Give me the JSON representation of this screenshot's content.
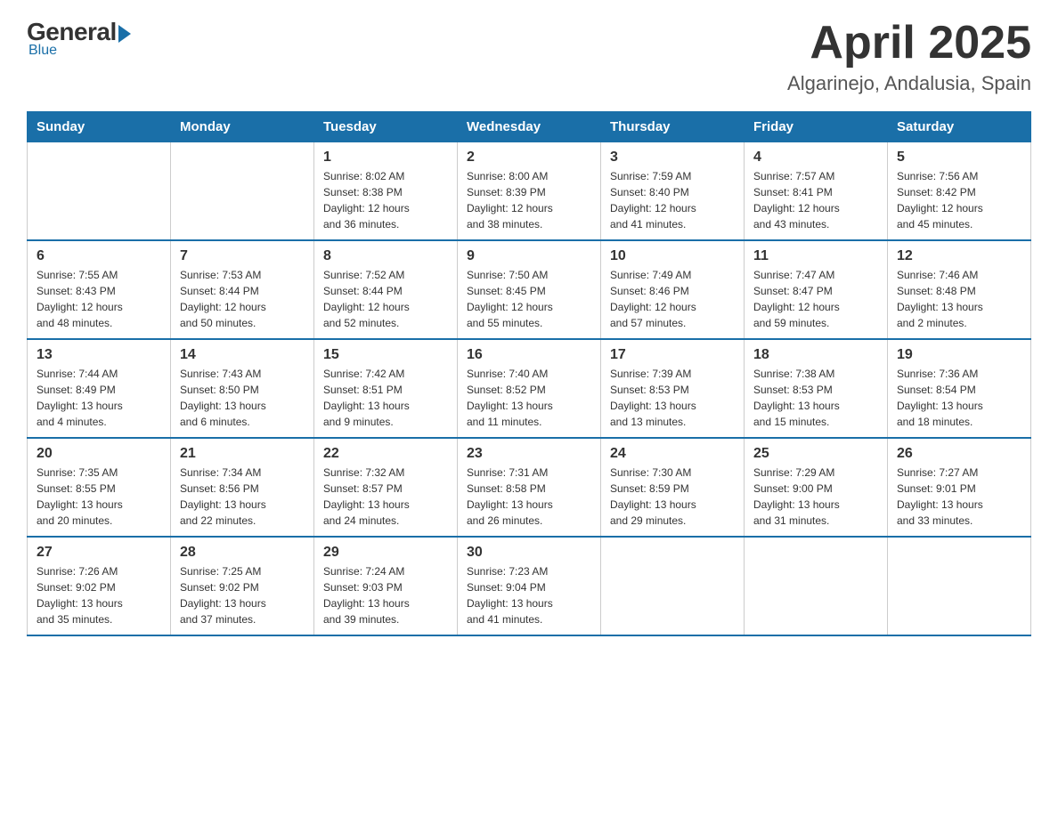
{
  "logo": {
    "general": "General",
    "blue": "Blue"
  },
  "title": "April 2025",
  "subtitle": "Algarinejo, Andalusia, Spain",
  "days_of_week": [
    "Sunday",
    "Monday",
    "Tuesday",
    "Wednesday",
    "Thursday",
    "Friday",
    "Saturday"
  ],
  "weeks": [
    [
      {
        "day": "",
        "info": ""
      },
      {
        "day": "",
        "info": ""
      },
      {
        "day": "1",
        "info": "Sunrise: 8:02 AM\nSunset: 8:38 PM\nDaylight: 12 hours\nand 36 minutes."
      },
      {
        "day": "2",
        "info": "Sunrise: 8:00 AM\nSunset: 8:39 PM\nDaylight: 12 hours\nand 38 minutes."
      },
      {
        "day": "3",
        "info": "Sunrise: 7:59 AM\nSunset: 8:40 PM\nDaylight: 12 hours\nand 41 minutes."
      },
      {
        "day": "4",
        "info": "Sunrise: 7:57 AM\nSunset: 8:41 PM\nDaylight: 12 hours\nand 43 minutes."
      },
      {
        "day": "5",
        "info": "Sunrise: 7:56 AM\nSunset: 8:42 PM\nDaylight: 12 hours\nand 45 minutes."
      }
    ],
    [
      {
        "day": "6",
        "info": "Sunrise: 7:55 AM\nSunset: 8:43 PM\nDaylight: 12 hours\nand 48 minutes."
      },
      {
        "day": "7",
        "info": "Sunrise: 7:53 AM\nSunset: 8:44 PM\nDaylight: 12 hours\nand 50 minutes."
      },
      {
        "day": "8",
        "info": "Sunrise: 7:52 AM\nSunset: 8:44 PM\nDaylight: 12 hours\nand 52 minutes."
      },
      {
        "day": "9",
        "info": "Sunrise: 7:50 AM\nSunset: 8:45 PM\nDaylight: 12 hours\nand 55 minutes."
      },
      {
        "day": "10",
        "info": "Sunrise: 7:49 AM\nSunset: 8:46 PM\nDaylight: 12 hours\nand 57 minutes."
      },
      {
        "day": "11",
        "info": "Sunrise: 7:47 AM\nSunset: 8:47 PM\nDaylight: 12 hours\nand 59 minutes."
      },
      {
        "day": "12",
        "info": "Sunrise: 7:46 AM\nSunset: 8:48 PM\nDaylight: 13 hours\nand 2 minutes."
      }
    ],
    [
      {
        "day": "13",
        "info": "Sunrise: 7:44 AM\nSunset: 8:49 PM\nDaylight: 13 hours\nand 4 minutes."
      },
      {
        "day": "14",
        "info": "Sunrise: 7:43 AM\nSunset: 8:50 PM\nDaylight: 13 hours\nand 6 minutes."
      },
      {
        "day": "15",
        "info": "Sunrise: 7:42 AM\nSunset: 8:51 PM\nDaylight: 13 hours\nand 9 minutes."
      },
      {
        "day": "16",
        "info": "Sunrise: 7:40 AM\nSunset: 8:52 PM\nDaylight: 13 hours\nand 11 minutes."
      },
      {
        "day": "17",
        "info": "Sunrise: 7:39 AM\nSunset: 8:53 PM\nDaylight: 13 hours\nand 13 minutes."
      },
      {
        "day": "18",
        "info": "Sunrise: 7:38 AM\nSunset: 8:53 PM\nDaylight: 13 hours\nand 15 minutes."
      },
      {
        "day": "19",
        "info": "Sunrise: 7:36 AM\nSunset: 8:54 PM\nDaylight: 13 hours\nand 18 minutes."
      }
    ],
    [
      {
        "day": "20",
        "info": "Sunrise: 7:35 AM\nSunset: 8:55 PM\nDaylight: 13 hours\nand 20 minutes."
      },
      {
        "day": "21",
        "info": "Sunrise: 7:34 AM\nSunset: 8:56 PM\nDaylight: 13 hours\nand 22 minutes."
      },
      {
        "day": "22",
        "info": "Sunrise: 7:32 AM\nSunset: 8:57 PM\nDaylight: 13 hours\nand 24 minutes."
      },
      {
        "day": "23",
        "info": "Sunrise: 7:31 AM\nSunset: 8:58 PM\nDaylight: 13 hours\nand 26 minutes."
      },
      {
        "day": "24",
        "info": "Sunrise: 7:30 AM\nSunset: 8:59 PM\nDaylight: 13 hours\nand 29 minutes."
      },
      {
        "day": "25",
        "info": "Sunrise: 7:29 AM\nSunset: 9:00 PM\nDaylight: 13 hours\nand 31 minutes."
      },
      {
        "day": "26",
        "info": "Sunrise: 7:27 AM\nSunset: 9:01 PM\nDaylight: 13 hours\nand 33 minutes."
      }
    ],
    [
      {
        "day": "27",
        "info": "Sunrise: 7:26 AM\nSunset: 9:02 PM\nDaylight: 13 hours\nand 35 minutes."
      },
      {
        "day": "28",
        "info": "Sunrise: 7:25 AM\nSunset: 9:02 PM\nDaylight: 13 hours\nand 37 minutes."
      },
      {
        "day": "29",
        "info": "Sunrise: 7:24 AM\nSunset: 9:03 PM\nDaylight: 13 hours\nand 39 minutes."
      },
      {
        "day": "30",
        "info": "Sunrise: 7:23 AM\nSunset: 9:04 PM\nDaylight: 13 hours\nand 41 minutes."
      },
      {
        "day": "",
        "info": ""
      },
      {
        "day": "",
        "info": ""
      },
      {
        "day": "",
        "info": ""
      }
    ]
  ]
}
